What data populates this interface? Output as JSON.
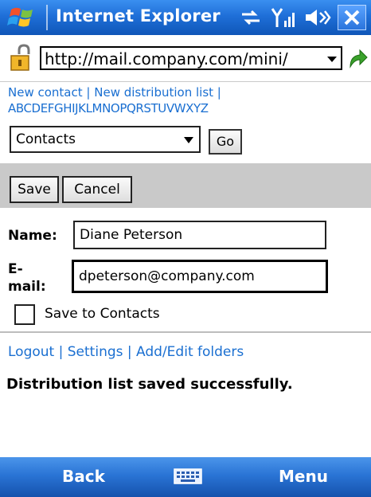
{
  "titlebar": {
    "title": "Internet Explorer",
    "icons": [
      "windows-flag-icon",
      "sync-arrows-icon",
      "signal-icon",
      "speaker-icon",
      "close-icon"
    ]
  },
  "address": {
    "url": "http://mail.company.com/mini/",
    "icons": [
      "lock-icon",
      "dropdown-arrow-icon",
      "go-arrow-icon"
    ]
  },
  "top_links": {
    "new_contact": "New contact",
    "separator": "|",
    "new_distribution_list": "New distribution list",
    "alphabet": "ABCDEFGHIJKLMNOPQRSTUVWXYZ"
  },
  "folder": {
    "selected": "Contacts",
    "go_label": "Go"
  },
  "form": {
    "save_label": "Save",
    "cancel_label": "Cancel",
    "name_label": "Name:",
    "name_value": "Diane Peterson",
    "email_label_1": "E-",
    "email_label_2": "mail:",
    "email_value": "dpeterson@company.com",
    "save_to_contacts_label": "Save to Contacts"
  },
  "bottom_links": {
    "logout": "Logout",
    "settings": "Settings",
    "add_edit_folders": "Add/Edit folders",
    "separator": "|"
  },
  "status_message": "Distribution list saved successfully.",
  "softkeys": {
    "left": "Back",
    "right": "Menu",
    "center_icon": "keyboard-icon"
  },
  "colors": {
    "title_blue": "#1f6fd8",
    "link_blue": "#1a6fd1",
    "panel_gray": "#c9c9c9"
  }
}
